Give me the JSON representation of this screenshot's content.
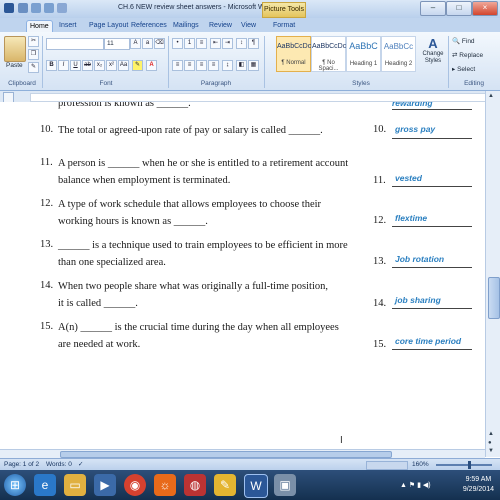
{
  "window": {
    "title": "CH.6 NEW review sheet answers - Microsoft W...",
    "contextual_tab": "Picture Tools",
    "controls": [
      "–",
      "□",
      "×"
    ]
  },
  "tabs": [
    "Home",
    "Insert",
    "Page Layout",
    "References",
    "Mailings",
    "Review",
    "View",
    "Format"
  ],
  "ribbon": {
    "clipboard": {
      "label": "Clipboard",
      "paste": "Paste"
    },
    "font": {
      "label": "Font",
      "size": "11"
    },
    "paragraph": {
      "label": "Paragraph"
    },
    "styles": {
      "label": "Styles",
      "items": [
        {
          "sample": "AaBbCcDc",
          "name": "¶ Normal"
        },
        {
          "sample": "AaBbCcDc",
          "name": "¶ No Spaci..."
        },
        {
          "sample": "AaBbC",
          "name": "Heading 1"
        },
        {
          "sample": "AaBbCc",
          "name": "Heading 2"
        }
      ],
      "change_styles": "Change Styles"
    },
    "editing": {
      "label": "Editing",
      "find": "Find",
      "replace": "Replace",
      "select": "Select"
    }
  },
  "document": {
    "top_fragment": "profession is known as ______.",
    "top_answer": "rewarding",
    "questions": [
      {
        "num": "10.",
        "lines": [
          "The total or agreed-upon rate of pay or salary is called ______."
        ],
        "answer_num": "10.",
        "answer": "gross pay"
      },
      {
        "num": "11.",
        "lines": [
          "A person is ______ when he or she is entitled to a retirement account",
          "balance when employment is terminated."
        ],
        "answer_num": "11.",
        "answer": "vested"
      },
      {
        "num": "12.",
        "lines": [
          "A type of work schedule that allows employees to choose their",
          "working hours is known as ______."
        ],
        "answer_num": "12.",
        "answer": "flextime"
      },
      {
        "num": "13.",
        "lines": [
          "______ is a technique used to train employees to be efficient in more",
          "than one specialized area."
        ],
        "answer_num": "13.",
        "answer": "Job rotation"
      },
      {
        "num": "14.",
        "lines": [
          "When two people share what was originally a full-time position,",
          "it is called ______."
        ],
        "answer_num": "14.",
        "answer": "job sharing"
      },
      {
        "num": "15.",
        "lines": [
          "A(n) ______ is the crucial time during the day when all employees",
          "are needed at work."
        ],
        "answer_num": "15.",
        "answer": "core time period"
      }
    ]
  },
  "status": {
    "page": "Page: 1 of 2",
    "words": "Words: 0",
    "zoom": "160%"
  },
  "clock": {
    "time": "9:59 AM",
    "date": "9/29/2014"
  }
}
